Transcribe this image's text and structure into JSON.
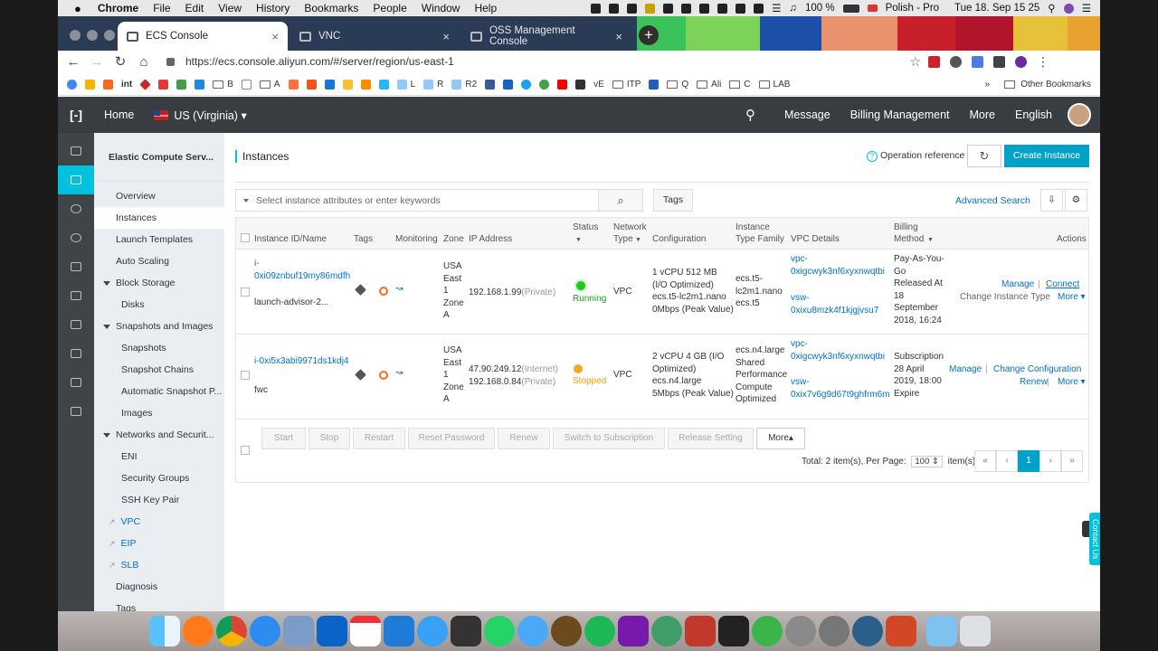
{
  "menubar": {
    "app": "Chrome",
    "items": [
      "File",
      "Edit",
      "View",
      "History",
      "Bookmarks",
      "People",
      "Window",
      "Help"
    ],
    "battery": "100 %",
    "input_source": "Polish - Pro",
    "clock": "Tue 18. Sep  15 25"
  },
  "tabs": [
    {
      "title": "ECS Console",
      "close": "×"
    },
    {
      "title": "VNC",
      "close": "×"
    },
    {
      "title": "OSS Management Console",
      "close": "×"
    }
  ],
  "newtab": "+",
  "toolbar": {
    "back": "←",
    "forward": "→",
    "reload": "↻",
    "home": "⌂",
    "url": "https://ecs.console.aliyun.com/#/server/region/us-east-1",
    "star": "☆",
    "menu": "⋮"
  },
  "bookmarks": {
    "items": [
      "int",
      "B",
      "A",
      "L",
      "R",
      "R2",
      "vE",
      "ITP",
      "Q",
      "Ali",
      "C",
      "LAB"
    ],
    "overflow": "»",
    "other": "Other Bookmarks"
  },
  "header": {
    "logo": "[-]",
    "home": "Home",
    "region": "US (Virginia)",
    "message": "Message",
    "billing": "Billing Management",
    "more": "More",
    "language": "English"
  },
  "sidebar": {
    "title": "Elastic Compute Serv...",
    "items": [
      {
        "label": "Overview"
      },
      {
        "label": "Instances"
      },
      {
        "label": "Launch Templates"
      },
      {
        "label": "Auto Scaling"
      },
      {
        "label": "Block Storage"
      },
      {
        "label": "Disks"
      },
      {
        "label": "Snapshots and Images"
      },
      {
        "label": "Snapshots"
      },
      {
        "label": "Snapshot Chains"
      },
      {
        "label": "Automatic Snapshot P..."
      },
      {
        "label": "Images"
      },
      {
        "label": "Networks and Securit..."
      },
      {
        "label": "ENI"
      },
      {
        "label": "Security Groups"
      },
      {
        "label": "SSH Key Pair"
      },
      {
        "label": "VPC"
      },
      {
        "label": "EIP"
      },
      {
        "label": "SLB"
      },
      {
        "label": "Diagnosis"
      },
      {
        "label": "Tags"
      }
    ]
  },
  "main": {
    "title": "Instances",
    "op_ref": "Operation reference",
    "refresh": "↻",
    "create": "Create Instance",
    "search_placeholder": "Select instance attributes or enter keywords",
    "search_icon": "⌕",
    "tags_btn": "Tags",
    "advanced": "Advanced Search",
    "export": "⇩",
    "settings": "⚙"
  },
  "table": {
    "headers": {
      "id": "Instance ID/Name",
      "tags": "Tags",
      "monitoring": "Monitoring",
      "zone": "Zone",
      "ip": "IP Address",
      "status": "Status",
      "network": "Network",
      "network2": "Type",
      "config": "Configuration",
      "family": "Instance",
      "family2": "Type Family",
      "vpc": "VPC Details",
      "billing": "Billing",
      "billing2": "Method",
      "actions": "Actions"
    },
    "rows": [
      {
        "id1": "i-",
        "id2": "0xi09znbuf19my86mdfh",
        "name": "launch-advisor-2...",
        "zone": [
          "USA",
          "East",
          "1",
          "Zone",
          "A"
        ],
        "ip": "192.168.1.99",
        "ip_tag": "(Private)",
        "status": "Running",
        "network": "VPC",
        "config": [
          "1 vCPU 512 MB",
          "(I/O Optimized)",
          "ecs.t5-lc2m1.nano",
          "0Mbps (Peak Value)"
        ],
        "family": [
          "ecs.t5-",
          "lc2m1.nano",
          "ecs.t5"
        ],
        "vpc": [
          "vpc-",
          "0xigcwyk3nf6xyxnwqtbi"
        ],
        "vsw": [
          "vsw-",
          "0xixu8mzk4f1kjgjvsu7"
        ],
        "billing": [
          "Pay-As-You-",
          "Go",
          "Released At",
          "18",
          "September",
          "2018, 16:24"
        ],
        "act_manage": "Manage",
        "act_connect": "Connect",
        "act_change": "Change Instance Type",
        "act_more": "More ▾"
      },
      {
        "id1": "i-0xi5x3abi9971ds1kdj4",
        "name": "fwc",
        "zone": [
          "USA",
          "East",
          "1",
          "Zone",
          "A"
        ],
        "ip1": "47.90.249.12",
        "ip1_tag": "(Internet)",
        "ip2": "192.168.0.84",
        "ip2_tag": "(Private)",
        "status": "Stopped",
        "network": "VPC",
        "config": [
          "2 vCPU 4 GB (I/O",
          "Optimized)",
          "ecs.n4.large",
          "5Mbps (Peak Value)"
        ],
        "family": [
          "ecs.n4.large",
          "Shared",
          "Performance",
          "Compute",
          "Optimized"
        ],
        "vpc": [
          "vpc-",
          "0xigcwyk3nf6xyxnwqtbi"
        ],
        "vsw": [
          "vsw-",
          "0xix7v6g9d67t9ghfrm6m"
        ],
        "billing": [
          "Subscription",
          "28 April",
          "2019, 18:00",
          "Expire"
        ],
        "act_manage": "Manage",
        "act_change": "Change Configuration",
        "act_renew": "Renew",
        "act_more": "More ▾"
      }
    ],
    "bulk": {
      "start": "Start",
      "stop": "Stop",
      "restart": "Restart",
      "reset": "Reset Password",
      "renew": "Renew",
      "switch": "Switch to Subscription",
      "release": "Release Setting",
      "more": "More▴"
    },
    "pagination": {
      "total": "Total: 2 item(s), Per Page:",
      "per_page": "100 ⇕",
      "suffix": "item(s)",
      "first": "«",
      "prev": "‹",
      "page": "1",
      "next": "›",
      "last": "»"
    }
  },
  "contact": "Contact Us"
}
